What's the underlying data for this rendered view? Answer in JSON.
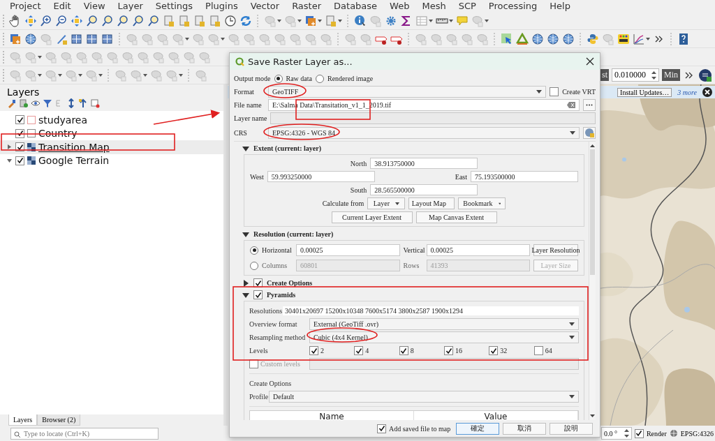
{
  "menu": [
    "Project",
    "Edit",
    "View",
    "Layer",
    "Settings",
    "Plugins",
    "Vector",
    "Raster",
    "Database",
    "Web",
    "Mesh",
    "SCP",
    "Processing",
    "Help"
  ],
  "layers_panel": {
    "title": "Layers",
    "layers": [
      {
        "name": "studyarea",
        "checked": true,
        "kind": "vector",
        "color": "#e89a9a",
        "selected": false
      },
      {
        "name": "Country",
        "checked": true,
        "kind": "vector",
        "color": "#8a8a8a",
        "selected": false
      },
      {
        "name": "Transition Map",
        "checked": true,
        "kind": "raster",
        "expanded": false,
        "selected": true
      },
      {
        "name": "Google Terrain",
        "checked": true,
        "kind": "raster",
        "expanded": true,
        "selected": false
      }
    ],
    "tabs": [
      {
        "label": "Layers",
        "selected": true
      },
      {
        "label": "Browser (2)",
        "selected": false
      }
    ]
  },
  "locator": {
    "placeholder": "Type to locate (Ctrl+K)"
  },
  "map_toolbar": {
    "label": "st",
    "value": "0.010000",
    "unit": "Min"
  },
  "message_bar": {
    "button": "Install Updates…",
    "link": "3 more"
  },
  "status_bar": {
    "rotation": "0.0 °",
    "render": {
      "label": "Render",
      "checked": true
    },
    "crs": "EPSG:4326"
  },
  "dialog": {
    "title": "Save Raster Layer as...",
    "output_mode": {
      "label": "Output mode",
      "options": [
        {
          "label": "Raw data",
          "selected": true
        },
        {
          "label": "Rendered image",
          "selected": false
        }
      ]
    },
    "format": {
      "label": "Format",
      "value": "GeoTIFF"
    },
    "create_vrt": {
      "label": "Create VRT",
      "checked": false
    },
    "file_name": {
      "label": "File name",
      "value": "E:\\Salma Data\\Transitation_v1_1_2019.tif"
    },
    "layer_name": {
      "label": "Layer name"
    },
    "crs": {
      "label": "CRS",
      "value": "EPSG:4326 - WGS 84"
    },
    "extent": {
      "title": "Extent (current: layer)",
      "expanded": true,
      "north": {
        "label": "North",
        "value": "38.913750000"
      },
      "west": {
        "label": "West",
        "value": "59.993250000"
      },
      "east": {
        "label": "East",
        "value": "75.193500000"
      },
      "south": {
        "label": "South",
        "value": "28.565500000"
      },
      "calculate_label": "Calculate from",
      "calculate_buttons": [
        "Layer",
        "Layout Map",
        "Bookmark"
      ],
      "buttons": [
        "Current Layer Extent",
        "Map Canvas Extent"
      ]
    },
    "resolution": {
      "title": "Resolution (current: layer)",
      "expanded": true,
      "modes": [
        {
          "label": "Horizontal",
          "selected": true,
          "value": "0.00025",
          "other_label": "Vertical",
          "other_value": "0.00025",
          "button": "Layer Resolution"
        },
        {
          "label": "Columns",
          "selected": false,
          "value": "60801",
          "other_label": "Rows",
          "other_value": "41393",
          "button": "Layer Size"
        }
      ]
    },
    "create_options_group": {
      "title": "Create Options",
      "expanded": false,
      "checked": true
    },
    "pyramids": {
      "title": "Pyramids",
      "expanded": true,
      "checked": true,
      "resolutions_label": "Resolutions",
      "resolutions": "30401x20697 15200x10348 7600x5174 3800x2587 1900x1294",
      "overview_format": {
        "label": "Overview format",
        "value": "External (GeoTiff .ovr)"
      },
      "resampling": {
        "label": "Resampling method",
        "value": "Cubic (4x4 Kernel)"
      },
      "levels_label": "Levels",
      "levels": [
        {
          "label": "2",
          "checked": true
        },
        {
          "label": "4",
          "checked": true
        },
        {
          "label": "8",
          "checked": true
        },
        {
          "label": "16",
          "checked": true
        },
        {
          "label": "32",
          "checked": true
        },
        {
          "label": "64",
          "checked": false
        }
      ],
      "custom_levels": {
        "label": "Custom levels",
        "checked": false
      }
    },
    "create_options": {
      "title": "Create Options",
      "profile_label": "Profile",
      "profile": "Default",
      "columns": [
        "Name",
        "Value"
      ]
    },
    "add_to_map": {
      "label": "Add saved file to map",
      "checked": true
    },
    "buttons": [
      {
        "label": "確定",
        "default": true
      },
      {
        "label": "取消",
        "default": false
      },
      {
        "label": "說明",
        "default": false
      }
    ]
  }
}
